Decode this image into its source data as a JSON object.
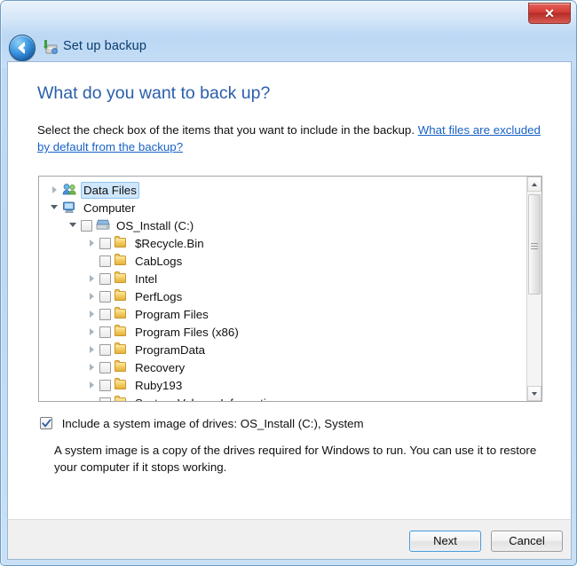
{
  "window": {
    "titlebar_text": "Set up backup",
    "close_label": "✕",
    "back_icon": "back-arrow-icon",
    "title_icon": "backup-icon"
  },
  "page": {
    "heading": "What do you want to back up?",
    "intro_text": "Select the check box of the items that you want to include in the backup. ",
    "intro_link": "What files are excluded by default from the backup?"
  },
  "tree": {
    "items": [
      {
        "label": "Data Files",
        "indent": 0,
        "twisty": "collapsed",
        "icon": "users-icon",
        "checkbox": "none",
        "selected": true
      },
      {
        "label": "Computer",
        "indent": 0,
        "twisty": "expanded",
        "icon": "computer-icon",
        "checkbox": "none",
        "selected": false
      },
      {
        "label": "OS_Install (C:)",
        "indent": 1,
        "twisty": "expanded",
        "icon": "drive-icon",
        "checkbox": "unchecked",
        "selected": false
      },
      {
        "label": "$Recycle.Bin",
        "indent": 2,
        "twisty": "collapsed",
        "icon": "folder-icon",
        "checkbox": "unchecked",
        "selected": false
      },
      {
        "label": "CabLogs",
        "indent": 2,
        "twisty": "none",
        "icon": "folder-icon",
        "checkbox": "unchecked",
        "selected": false
      },
      {
        "label": "Intel",
        "indent": 2,
        "twisty": "collapsed",
        "icon": "folder-icon",
        "checkbox": "unchecked",
        "selected": false
      },
      {
        "label": "PerfLogs",
        "indent": 2,
        "twisty": "collapsed",
        "icon": "folder-icon",
        "checkbox": "unchecked",
        "selected": false
      },
      {
        "label": "Program Files",
        "indent": 2,
        "twisty": "collapsed",
        "icon": "folder-icon",
        "checkbox": "unchecked",
        "selected": false
      },
      {
        "label": "Program Files (x86)",
        "indent": 2,
        "twisty": "collapsed",
        "icon": "folder-icon",
        "checkbox": "unchecked",
        "selected": false
      },
      {
        "label": "ProgramData",
        "indent": 2,
        "twisty": "collapsed",
        "icon": "folder-icon",
        "checkbox": "unchecked",
        "selected": false
      },
      {
        "label": "Recovery",
        "indent": 2,
        "twisty": "collapsed",
        "icon": "folder-icon",
        "checkbox": "unchecked",
        "selected": false
      },
      {
        "label": "Ruby193",
        "indent": 2,
        "twisty": "collapsed",
        "icon": "folder-icon",
        "checkbox": "unchecked",
        "selected": false
      },
      {
        "label": "System Volume Information",
        "indent": 2,
        "twisty": "none",
        "icon": "folder-icon",
        "checkbox": "unchecked",
        "selected": false
      }
    ]
  },
  "system_image": {
    "checked": true,
    "label": "Include a system image of drives: OS_Install (C:), System",
    "description": "A system image is a copy of the drives required for Windows to run. You can use it to restore your computer if it stops working."
  },
  "footer": {
    "next_label": "Next",
    "cancel_label": "Cancel"
  },
  "colors": {
    "titlebar": "#bcd8f4",
    "heading": "#2a5eab",
    "link": "#1862c6",
    "selection": "#cfe6fb",
    "close_red": "#d23b34",
    "default_button_border": "#4b9bd6"
  }
}
